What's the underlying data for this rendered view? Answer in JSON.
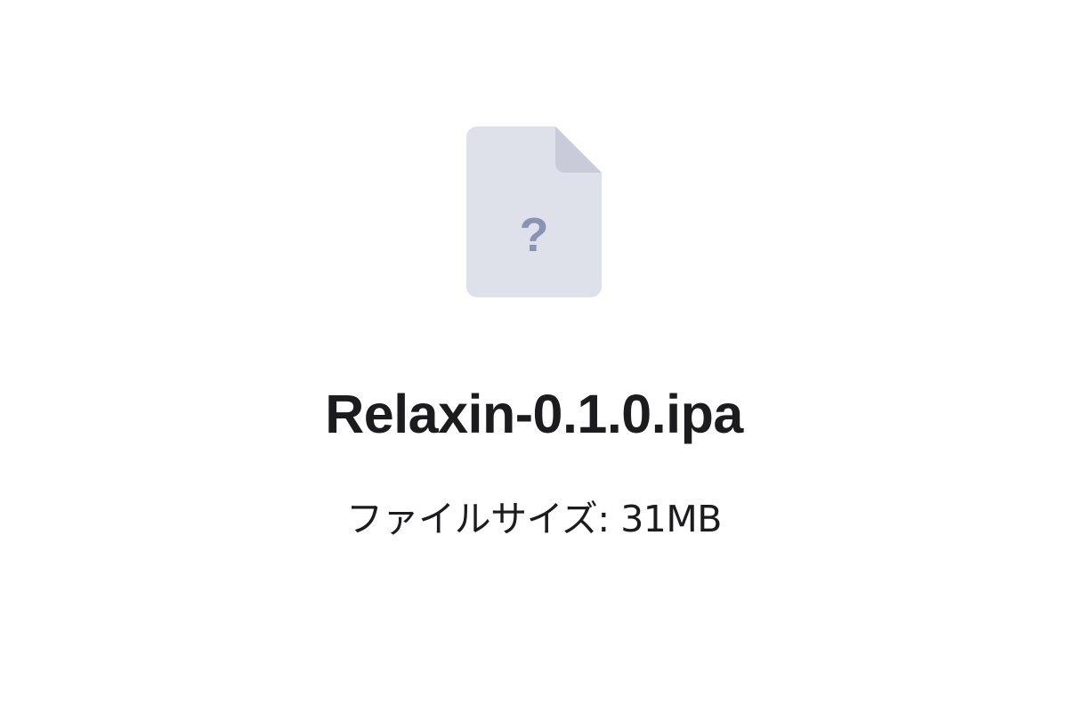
{
  "file": {
    "icon": "unknown-file-icon",
    "icon_glyph": "?",
    "name": "Relaxin-0.1.0.ipa",
    "size_label": "ファイルサイズ: 31MB"
  },
  "colors": {
    "icon_body": "#dfe1ea",
    "icon_fold": "#c9ccd8",
    "icon_glyph": "#8b93b4",
    "text": "#1c1c1e",
    "background": "#ffffff"
  }
}
